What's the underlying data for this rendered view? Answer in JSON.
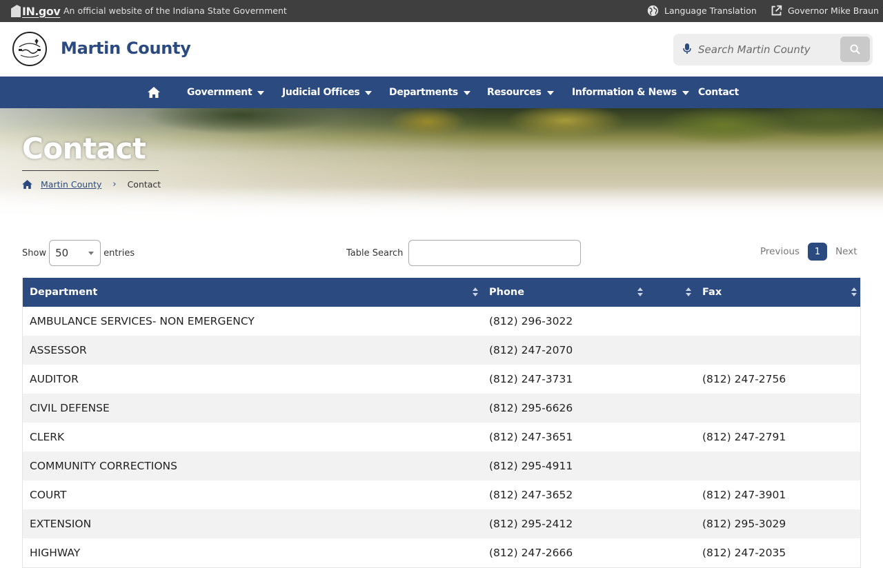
{
  "statebar": {
    "ingov_logo": "IN.gov",
    "official_text": "An official website of the Indiana State Government",
    "language_label": "Language Translation",
    "governor_label": "Governor Mike Braun"
  },
  "header": {
    "site_title": "Martin County",
    "search_placeholder": "Search Martin County"
  },
  "nav": {
    "items": [
      {
        "label": "Government",
        "dropdown": true
      },
      {
        "label": "Judicial Offices",
        "dropdown": true
      },
      {
        "label": "Departments",
        "dropdown": true
      },
      {
        "label": "Resources",
        "dropdown": true
      },
      {
        "label": "Information & News",
        "dropdown": true
      },
      {
        "label": "Contact",
        "dropdown": false
      }
    ]
  },
  "hero": {
    "title": "Contact",
    "breadcrumb": {
      "home": "Martin County",
      "current": "Contact"
    }
  },
  "controls": {
    "show_label": "Show",
    "entries_value": "50",
    "entries_label": "entries",
    "search_label": "Table Search",
    "search_value": "",
    "previous": "Previous",
    "current_page": "1",
    "next": "Next"
  },
  "table": {
    "headers": [
      "Department",
      "Phone",
      "Fax"
    ],
    "rows": [
      {
        "department": "AMBULANCE SERVICES- NON EMERGENCY",
        "phone": "(812) 296-3022",
        "fax": ""
      },
      {
        "department": "ASSESSOR",
        "phone": "(812) 247-2070",
        "fax": ""
      },
      {
        "department": "AUDITOR",
        "phone": "(812) 247-3731",
        "fax": "(812) 247-2756"
      },
      {
        "department": "CIVIL DEFENSE",
        "phone": "(812) 295-6626",
        "fax": ""
      },
      {
        "department": "CLERK",
        "phone": "(812) 247-3651",
        "fax": "(812) 247-2791"
      },
      {
        "department": "COMMUNITY CORRECTIONS",
        "phone": "(812) 295-4911",
        "fax": ""
      },
      {
        "department": "COURT",
        "phone": "(812) 247-3652",
        "fax": "(812) 247-3901"
      },
      {
        "department": "EXTENSION",
        "phone": "(812) 295-2412",
        "fax": "(812) 295-3029"
      },
      {
        "department": "HIGHWAY",
        "phone": "(812) 247-2666",
        "fax": "(812) 247-2035"
      }
    ]
  },
  "colors": {
    "brand_blue": "#2b4a80",
    "statebar_gray": "#3f3f3f"
  }
}
